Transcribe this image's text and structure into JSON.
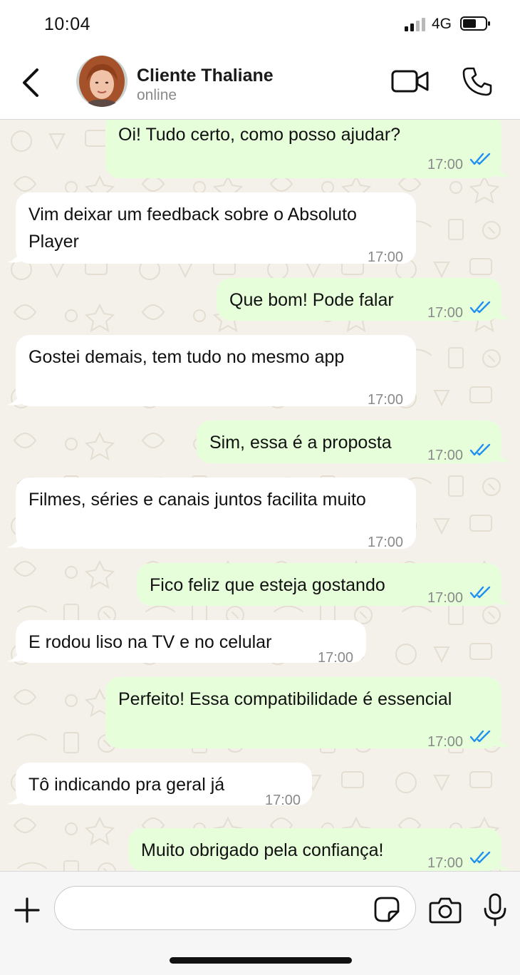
{
  "status_bar": {
    "time": "10:04",
    "network": "4G"
  },
  "header": {
    "contact_name": "Cliente Thaliane",
    "contact_status": "online",
    "icons": [
      "back-arrow-icon",
      "avatar",
      "video-camera-icon",
      "phone-icon"
    ]
  },
  "messages": [
    {
      "direction": "out",
      "text": "Oi! Tudo certo, como posso ajudar?",
      "time": "17:00",
      "read": true
    },
    {
      "direction": "in",
      "text": "Vim deixar um feedback sobre o Absoluto Player",
      "time": "17:00"
    },
    {
      "direction": "out",
      "text": "Que bom! Pode falar",
      "time": "17:00",
      "read": true
    },
    {
      "direction": "in",
      "text": "Gostei demais, tem tudo no mesmo app",
      "time": "17:00"
    },
    {
      "direction": "out",
      "text": "Sim, essa é a proposta",
      "time": "17:00",
      "read": true
    },
    {
      "direction": "in",
      "text": "Filmes, séries e canais juntos facilita muito",
      "time": "17:00"
    },
    {
      "direction": "out",
      "text": "Fico feliz que esteja gostando",
      "time": "17:00",
      "read": true
    },
    {
      "direction": "in",
      "text": "E rodou liso na TV e no celular",
      "time": "17:00"
    },
    {
      "direction": "out",
      "text": "Perfeito! Essa compatibilidade é essencial",
      "time": "17:00",
      "read": true
    },
    {
      "direction": "in",
      "text": "Tô indicando pra geral já",
      "time": "17:00"
    },
    {
      "direction": "out",
      "text": "Muito obrigado pela confiança!",
      "time": "17:00",
      "read": true
    }
  ],
  "composer": {
    "placeholder": "",
    "value": "",
    "icons": [
      "plus-icon",
      "sticker-icon",
      "camera-icon",
      "microphone-icon"
    ]
  },
  "colors": {
    "outgoing_bubble": "#e6ffda",
    "incoming_bubble": "#ffffff",
    "chat_background": "#f4f1ea",
    "read_ticks": "#1f8ff0"
  }
}
